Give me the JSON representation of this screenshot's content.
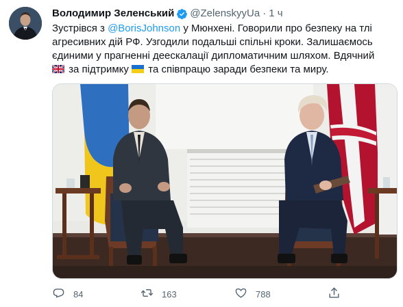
{
  "tweet": {
    "author_name": "Володимир Зеленський",
    "handle": "@ZelenskyyUa",
    "separator": "·",
    "time": "1 ч",
    "text_prefix": "Зустрівся з ",
    "mention": "@BorisJohnson",
    "text_after_mention": " у Мюнхені. Говорили про безпеку на тлі",
    "line2": "агресивних дій РФ. Узгодили подальші спільні кроки. Залишаємось",
    "line3": "єдиними у прагненні деескалації дипломатичним шляхом. Вдячний",
    "line4_a": " за підтримку ",
    "line4_b": " та співпрацю заради безпеки та миру."
  },
  "actions": {
    "replies": "84",
    "retweets": "163",
    "likes": "788"
  },
  "icons": {
    "verified": "verified-badge-icon",
    "reply": "reply-icon",
    "retweet": "retweet-icon",
    "like": "heart-icon",
    "share": "share-icon",
    "flag_uk": "uk-flag-icon",
    "flag_ua": "ukraine-flag-icon"
  },
  "colors": {
    "accent": "#1d9bf0",
    "secondary_text": "#536471",
    "primary_text": "#0f1419"
  }
}
